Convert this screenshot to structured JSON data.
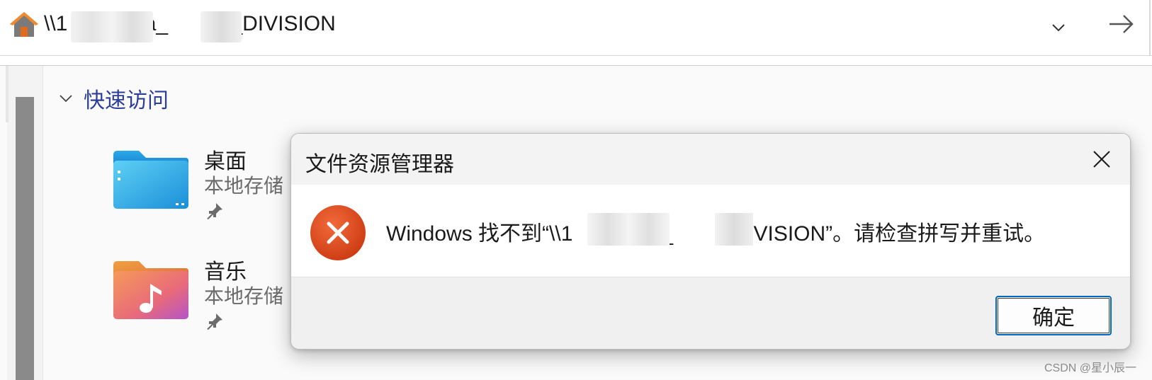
{
  "address_bar": {
    "path": "\\\\1          8\\a_        C_DIVISION",
    "icons": {
      "home": "home-icon",
      "dropdown": "chevron-down-icon",
      "go": "arrow-right-icon"
    }
  },
  "quick_access": {
    "title": "快速访问",
    "items": [
      {
        "name": "桌面",
        "subtitle": "本地存储",
        "icon": "desktop-folder-icon",
        "pinned": true
      },
      {
        "name": "音乐",
        "subtitle": "本地存储",
        "icon": "music-folder-icon",
        "pinned": true
      }
    ]
  },
  "dialog": {
    "title": "文件资源管理器",
    "message": "Windows 找不到“\\\\1          8\\a_        _DIVISION”。请检查拼写并重试。",
    "ok_label": "确定",
    "icons": {
      "error": "error-icon",
      "close": "close-icon"
    },
    "colors": {
      "error": "#e04a1f",
      "accent": "#0067c0"
    }
  },
  "watermark": "CSDN @星小辰一"
}
